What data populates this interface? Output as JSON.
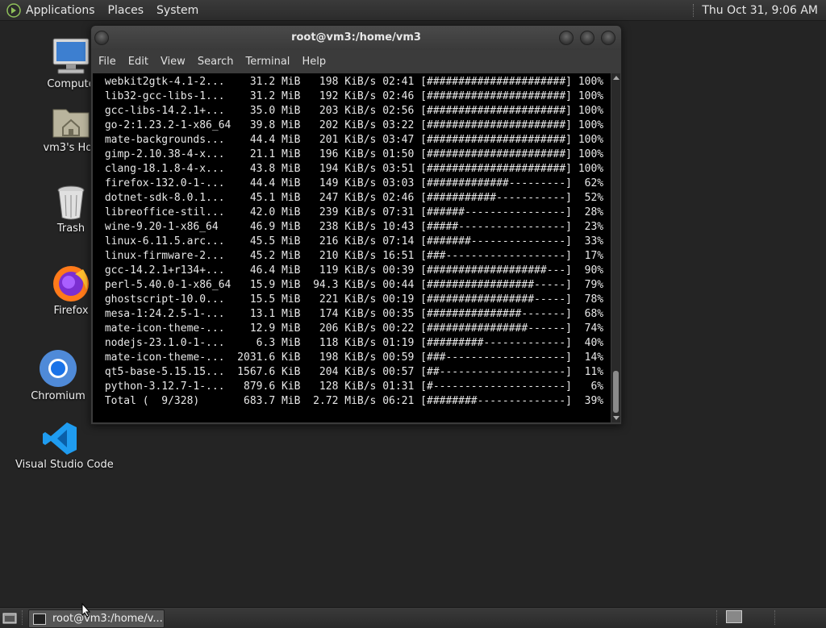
{
  "top_panel": {
    "menus": [
      "Applications",
      "Places",
      "System"
    ],
    "clock": "Thu Oct 31,  9:06 AM"
  },
  "desktop_icons": [
    {
      "label": "Compute",
      "icon": "computer-icon"
    },
    {
      "label": "vm3's Hon",
      "icon": "home-folder-icon"
    },
    {
      "label": "Trash",
      "icon": "trash-icon"
    },
    {
      "label": "Firefox",
      "icon": "firefox-icon"
    },
    {
      "label": "Chromium",
      "icon": "chromium-icon"
    },
    {
      "label": "Visual Studio Code",
      "icon": "vscode-icon"
    }
  ],
  "terminal": {
    "title": "root@vm3:/home/vm3",
    "menu": [
      "File",
      "Edit",
      "View",
      "Search",
      "Terminal",
      "Help"
    ],
    "lines": [
      " webkit2gtk-4.1-2...    31.2 MiB   198 KiB/s 02:41 [######################] 100%",
      " lib32-gcc-libs-1...    31.2 MiB   192 KiB/s 02:46 [######################] 100%",
      " gcc-libs-14.2.1+...    35.0 MiB   203 KiB/s 02:56 [######################] 100%",
      " go-2:1.23.2-1-x86_64   39.8 MiB   202 KiB/s 03:22 [######################] 100%",
      " mate-backgrounds...    44.4 MiB   201 KiB/s 03:47 [######################] 100%",
      " gimp-2.10.38-4-x...    21.1 MiB   196 KiB/s 01:50 [######################] 100%",
      " clang-18.1.8-4-x...    43.8 MiB   194 KiB/s 03:51 [######################] 100%",
      " firefox-132.0-1-...    44.4 MiB   149 KiB/s 03:03 [#############---------]  62%",
      " dotnet-sdk-8.0.1...    45.1 MiB   247 KiB/s 02:46 [###########-----------]  52%",
      " libreoffice-stil...    42.0 MiB   239 KiB/s 07:31 [######----------------]  28%",
      " wine-9.20-1-x86_64     46.9 MiB   238 KiB/s 10:43 [#####-----------------]  23%",
      " linux-6.11.5.arc...    45.5 MiB   216 KiB/s 07:14 [#######---------------]  33%",
      " linux-firmware-2...    45.2 MiB   210 KiB/s 16:51 [###-------------------]  17%",
      " gcc-14.2.1+r134+...    46.4 MiB   119 KiB/s 00:39 [###################---]  90%",
      " perl-5.40.0-1-x86_64   15.9 MiB  94.3 KiB/s 00:44 [#################-----]  79%",
      " ghostscript-10.0...    15.5 MiB   221 KiB/s 00:19 [#################-----]  78%",
      " mesa-1:24.2.5-1-...    13.1 MiB   174 KiB/s 00:35 [###############-------]  68%",
      " mate-icon-theme-...    12.9 MiB   206 KiB/s 00:22 [################------]  74%",
      " nodejs-23.1.0-1-...     6.3 MiB   118 KiB/s 01:19 [#########-------------]  40%",
      " mate-icon-theme-...  2031.6 KiB   198 KiB/s 00:59 [###-------------------]  14%",
      " qt5-base-5.15.15...  1567.6 KiB   204 KiB/s 00:57 [##--------------------]  11%",
      " python-3.12.7-1-...   879.6 KiB   128 KiB/s 01:31 [#---------------------]   6%",
      " Total (  9/328)       683.7 MiB  2.72 MiB/s 06:21 [########--------------]  39%"
    ]
  },
  "taskbar": {
    "task_label": "root@vm3:/home/v..."
  }
}
